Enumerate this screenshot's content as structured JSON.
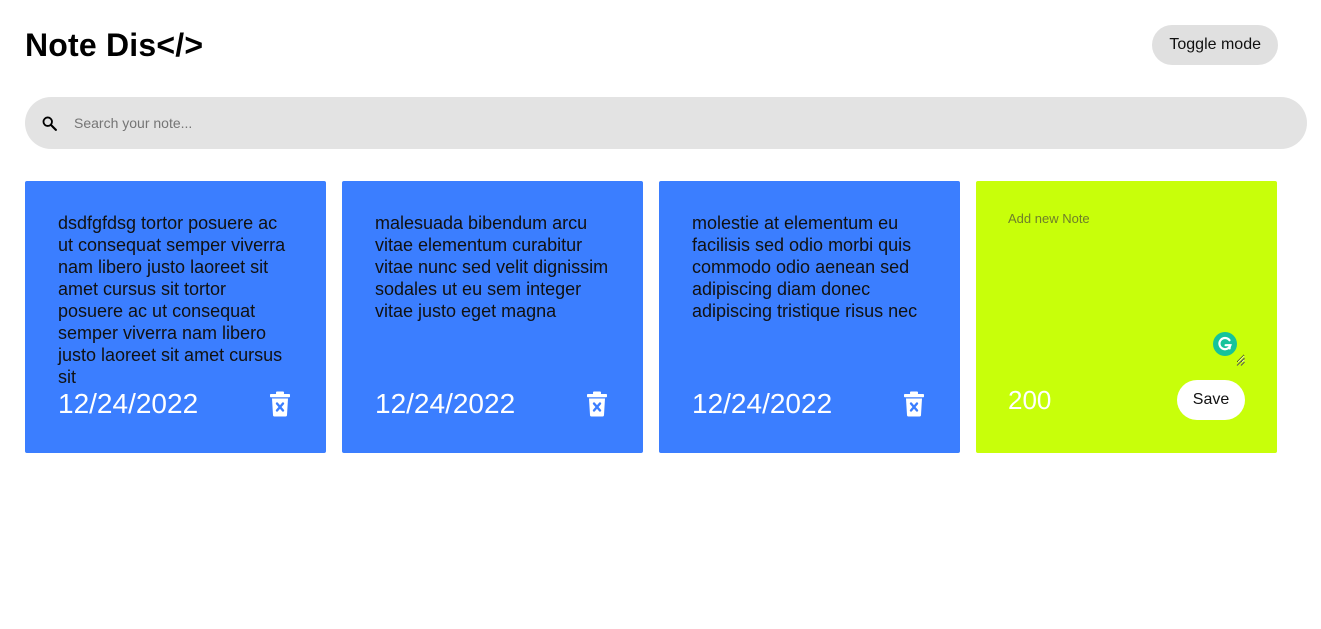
{
  "header": {
    "title": "Note Dis</>",
    "toggle_label": "Toggle mode"
  },
  "search": {
    "icon": "search-icon",
    "placeholder": "Search your note...",
    "value": ""
  },
  "notes": [
    {
      "text": "dsdfgfdsg tortor posuere ac ut consequat semper viverra nam libero justo laoreet sit amet cursus sit tortor posuere ac ut consequat semper viverra nam libero justo laoreet sit amet cursus sit",
      "date": "12/24/2022",
      "delete_icon": "trash-delete-icon"
    },
    {
      "text": "malesuada bibendum arcu vitae elementum curabitur vitae nunc sed velit dignissim sodales ut eu sem integer vitae justo eget magna",
      "date": "12/24/2022",
      "delete_icon": "trash-delete-icon"
    },
    {
      "text": "molestie at elementum eu facilisis sed odio morbi quis commodo odio aenean sed adipiscing diam donec adipiscing tristique risus nec",
      "date": "12/24/2022",
      "delete_icon": "trash-delete-icon"
    }
  ],
  "new_note": {
    "placeholder": "Add new Note",
    "value": "",
    "remaining_chars": "200",
    "save_label": "Save"
  },
  "colors": {
    "note_background": "#3b7eff",
    "new_note_background": "#c8ff0a",
    "search_background": "#e3e3e3",
    "toggle_background": "#e0e0e0",
    "grammarly": "#15c39a"
  }
}
